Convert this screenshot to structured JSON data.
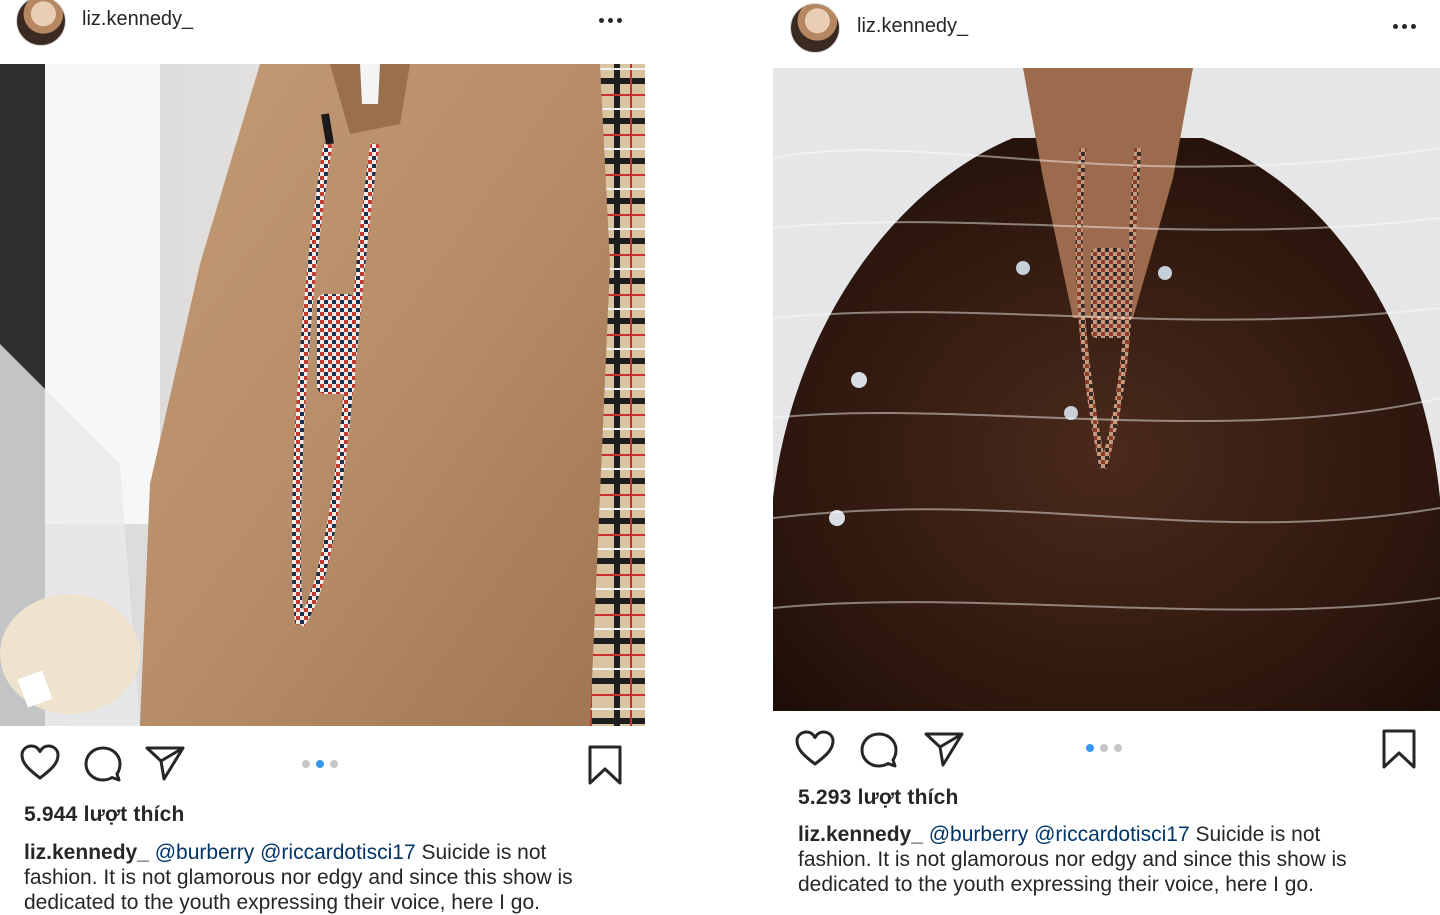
{
  "posts": [
    {
      "username": "liz.kennedy_",
      "likes_text": "5.944 lượt thích",
      "caption": {
        "user": "liz.kennedy_",
        "mention1": "@burberry",
        "mention2": "@riccardotisci17",
        "line1_rest": "Suicide is not",
        "line2": "fashion. It is not glamorous nor edgy and since this show is",
        "line3": "dedicated to the youth expressing their voice, here I go."
      },
      "carousel": {
        "count": 3,
        "active_index": 1
      }
    },
    {
      "username": "liz.kennedy_",
      "likes_text": "5.293 lượt thích",
      "caption": {
        "user": "liz.kennedy_",
        "mention1": "@burberry",
        "mention2": "@riccardotisci17",
        "line1_rest": "Suicide is not",
        "line2": "fashion. It is not glamorous nor edgy and since this show is",
        "line3": "dedicated to the youth expressing their voice, here I go."
      },
      "carousel": {
        "count": 3,
        "active_index": 0
      }
    }
  ],
  "icons": {
    "like": "heart-icon",
    "comment": "comment-icon",
    "share": "send-icon",
    "save": "bookmark-icon",
    "more": "more-icon"
  },
  "colors": {
    "text": "#262626",
    "mention": "#003569",
    "dot_active": "#3897f0",
    "dot_inactive": "#c7c7c7"
  }
}
